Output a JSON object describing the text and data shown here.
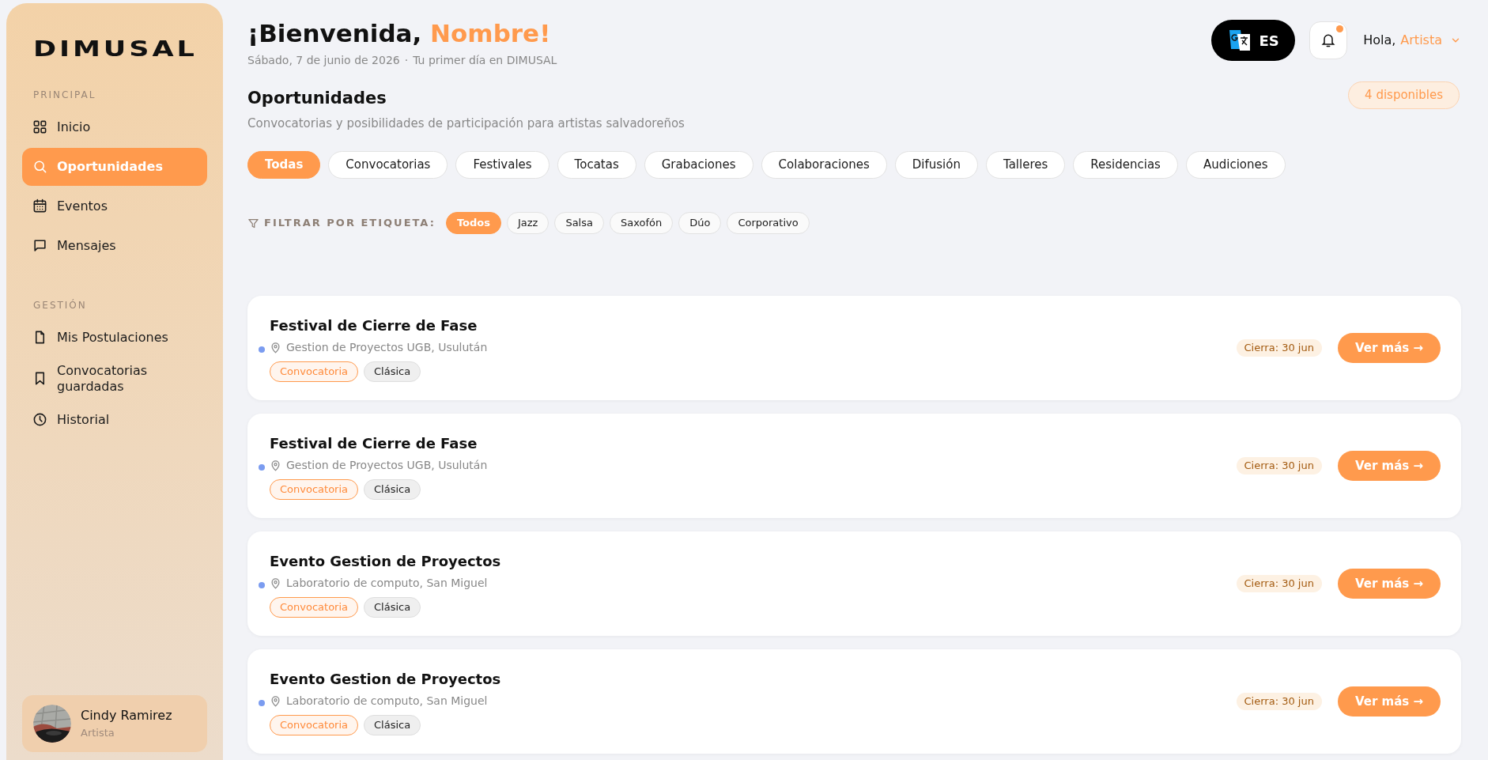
{
  "sidebar": {
    "logo": "DIMUSAL",
    "sections": [
      {
        "title": "PRINCIPAL",
        "items": [
          {
            "label": "Inicio",
            "kind": "grid",
            "selected": false
          },
          {
            "label": "Oportunidades",
            "kind": "search",
            "selected": true
          },
          {
            "label": "Eventos",
            "kind": "calendar",
            "selected": false
          },
          {
            "label": "Mensajes",
            "kind": "message",
            "selected": false
          }
        ]
      },
      {
        "title": "GESTIÓN",
        "items": [
          {
            "label": "Mis Postulaciones",
            "kind": "file",
            "selected": false
          },
          {
            "label": "Convocatorias guardadas",
            "kind": "bookmark",
            "selected": false
          },
          {
            "label": "Historial",
            "kind": "clock",
            "selected": false
          }
        ]
      }
    ],
    "profile": {
      "name": "Cindy Ramirez",
      "role": "Artista"
    }
  },
  "header": {
    "greeting": "¡Bienvenida, ",
    "name": "Nombre!",
    "date": "Sábado, 7 de junio de 2026",
    "separator": "·",
    "note": "Tu primer día en DIMUSAL",
    "language": "ES",
    "notification": true,
    "hello": "Hola,",
    "user": "Artista"
  },
  "section": {
    "title": "Oportunidades",
    "subtitle": "Convocatorias y posibilidades de participación para artistas salvadoreños",
    "count": "4 disponibles"
  },
  "categories": [
    {
      "label": "Todas",
      "selected": true
    },
    {
      "label": "Convocatorias",
      "selected": false
    },
    {
      "label": "Festivales",
      "selected": false
    },
    {
      "label": "Tocatas",
      "selected": false
    },
    {
      "label": "Grabaciones",
      "selected": false
    },
    {
      "label": "Colaboraciones",
      "selected": false
    },
    {
      "label": "Difusión",
      "selected": false
    },
    {
      "label": "Talleres",
      "selected": false
    },
    {
      "label": "Residencias",
      "selected": false
    },
    {
      "label": "Audiciones",
      "selected": false
    }
  ],
  "tag_filter": {
    "label": "FILTRAR POR ETIQUETA:",
    "tags": [
      {
        "label": "Todos",
        "selected": true
      },
      {
        "label": "Jazz",
        "selected": false
      },
      {
        "label": "Salsa",
        "selected": false
      },
      {
        "label": "Saxofón",
        "selected": false
      },
      {
        "label": "Dúo",
        "selected": false
      },
      {
        "label": "Corporativo",
        "selected": false
      }
    ]
  },
  "opportunities": [
    {
      "title": "Festival de Cierre de Fase",
      "location": "Gestion de Proyectos UGB, Usulután",
      "tags": [
        {
          "label": "Convocatoria",
          "kind": "type"
        },
        {
          "label": "Clásica",
          "kind": "genre"
        }
      ],
      "deadline": "Cierra: 30 jun",
      "action": "Ver más →"
    },
    {
      "title": "Festival de Cierre de Fase",
      "location": "Gestion de Proyectos UGB, Usulután",
      "tags": [
        {
          "label": "Convocatoria",
          "kind": "type"
        },
        {
          "label": "Clásica",
          "kind": "genre"
        }
      ],
      "deadline": "Cierra: 30 jun",
      "action": "Ver más →"
    },
    {
      "title": "Evento Gestion de Proyectos",
      "location": "Laboratorio de computo, San Miguel",
      "tags": [
        {
          "label": "Convocatoria",
          "kind": "type"
        },
        {
          "label": "Clásica",
          "kind": "genre"
        }
      ],
      "deadline": "Cierra: 30 jun",
      "action": "Ver más →"
    },
    {
      "title": "Evento Gestion de Proyectos",
      "location": "Laboratorio de computo, San Miguel",
      "tags": [
        {
          "label": "Convocatoria",
          "kind": "type"
        },
        {
          "label": "Clásica",
          "kind": "genre"
        }
      ],
      "deadline": "Cierra: 30 jun",
      "action": "Ver más →"
    }
  ]
}
